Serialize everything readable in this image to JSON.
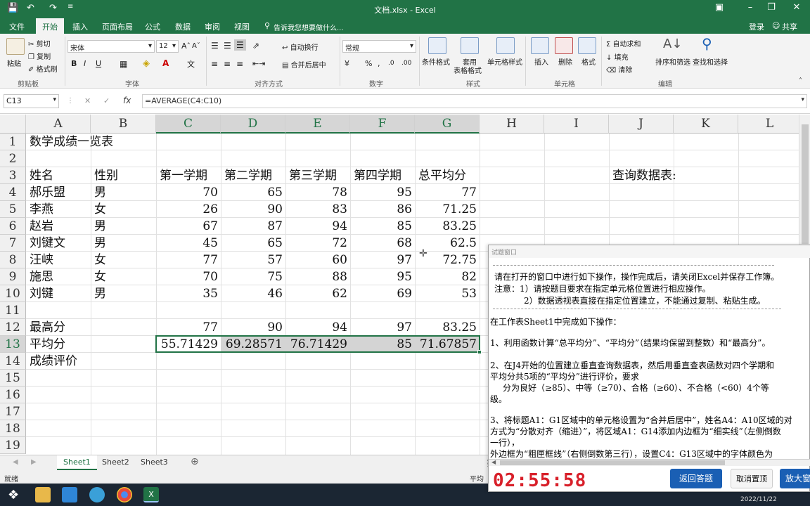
{
  "window": {
    "title": "文档.xlsx - Excel"
  },
  "ribbon_tabs": [
    "文件",
    "开始",
    "插入",
    "页面布局",
    "公式",
    "数据",
    "审阅",
    "视图"
  ],
  "tellme": "告诉我您想要做什么...",
  "account": {
    "login": "登录",
    "share": "共享"
  },
  "ribbon": {
    "clipboard": {
      "paste": "粘贴",
      "cut": "剪切",
      "copy": "复制",
      "format_painter": "格式刷",
      "label": "剪贴板"
    },
    "font": {
      "name": "宋体",
      "size": "12",
      "label": "字体"
    },
    "alignment": {
      "wrap": "自动换行",
      "merge": "合并后居中",
      "label": "对齐方式"
    },
    "number": {
      "format": "常规",
      "label": "数字"
    },
    "styles": {
      "conditional": "条件格式",
      "table1": "套用",
      "table2": "表格格式",
      "cell_styles": "单元格样式",
      "label": "样式"
    },
    "cells": {
      "insert": "插入",
      "delete": "删除",
      "format": "格式",
      "label": "单元格"
    },
    "editing": {
      "autosum": "自动求和",
      "fill": "填充",
      "clear": "清除",
      "sort": "排序和筛选",
      "find": "查找和选择",
      "label": "编辑"
    }
  },
  "formula_bar": {
    "name_box": "C13",
    "formula": "=AVERAGE(C4:C10)"
  },
  "columns": [
    "A",
    "B",
    "C",
    "D",
    "E",
    "F",
    "G",
    "H",
    "I",
    "J",
    "K",
    "L"
  ],
  "rows": [
    "1",
    "2",
    "3",
    "4",
    "5",
    "6",
    "7",
    "8",
    "9",
    "10",
    "11",
    "12",
    "13",
    "14",
    "15",
    "16",
    "17",
    "18",
    "19"
  ],
  "sheet": {
    "title": "数学成绩一览表",
    "headers": [
      "姓名",
      "性别",
      "第一学期",
      "第二学期",
      "第三学期",
      "第四学期",
      "总平均分"
    ],
    "query_label": "查询数据表:",
    "students": [
      {
        "name": "郝乐盟",
        "gender": "男",
        "s1": "70",
        "s2": "65",
        "s3": "78",
        "s4": "95",
        "avg": "77"
      },
      {
        "name": "李燕",
        "gender": "女",
        "s1": "26",
        "s2": "90",
        "s3": "83",
        "s4": "86",
        "avg": "71.25"
      },
      {
        "name": "赵岩",
        "gender": "男",
        "s1": "67",
        "s2": "87",
        "s3": "94",
        "s4": "85",
        "avg": "83.25"
      },
      {
        "name": "刘键文",
        "gender": "男",
        "s1": "45",
        "s2": "65",
        "s3": "72",
        "s4": "68",
        "avg": "62.5"
      },
      {
        "name": "汪峡",
        "gender": "女",
        "s1": "77",
        "s2": "57",
        "s3": "60",
        "s4": "97",
        "avg": "72.75"
      },
      {
        "name": "施思",
        "gender": "女",
        "s1": "70",
        "s2": "75",
        "s3": "88",
        "s4": "95",
        "avg": "82"
      },
      {
        "name": "刘键",
        "gender": "男",
        "s1": "35",
        "s2": "46",
        "s3": "62",
        "s4": "69",
        "avg": "53"
      }
    ],
    "max_row": {
      "label": "最高分",
      "values": [
        "77",
        "90",
        "94",
        "97",
        "83.25"
      ]
    },
    "avg_row": {
      "label": "平均分",
      "values": [
        "55.71429",
        "69.28571",
        "76.71429",
        "85",
        "71.67857"
      ]
    },
    "eval_row": {
      "label": "成绩评价"
    }
  },
  "sheet_tabs": [
    "Sheet1",
    "Sheet2",
    "Sheet3"
  ],
  "status": {
    "ready": "就绪",
    "avg_partial": "平均"
  },
  "exam": {
    "window_title": "试题窗口",
    "lines": [
      "请在打开的窗口中进行如下操作，操作完成后，请关闭Excel并保存工作簿。",
      "注意：1）请按题目要求在指定单元格位置进行相应操作。",
      "2）数据透视表直接在指定位置建立，不能通过复制、粘贴生成。",
      "在工作表Sheet1中完成如下操作：",
      "1、利用函数计算“总平均分”、“平均分”（结果均保留到整数）和“最高分”。",
      "2、在J4开始的位置建立垂直查询数据表，然后用垂直查表函数对四个学期和",
      "平均分共5项的“平均分”进行评价，要求",
      "分为良好（≥85）、中等（≥70）、合格（≥60）、不合格（<60）4个等",
      "级。",
      "3、将标题A1：G1区域中的单元格设置为“合并后居中”，姓名A4：A10区域的对",
      "方式为“分散对齐（缩进）”，将区域A1：G14添加内边框为“细实线”（左侧倒数",
      "一行），",
      "外边框为“粗匣框线”（右侧倒数第三行），设置C4：G13区域中的字体颜色为"
    ],
    "timer": "02:55:58",
    "back_button": "返回答题",
    "cancel_button": "取消置顶",
    "zoom_button": "放大窗"
  },
  "taskbar": {
    "date": "2022/11/22"
  },
  "colors": {
    "excel_green": "#217346",
    "timer_red": "#d8202a",
    "button_blue": "#1a5fb4"
  }
}
